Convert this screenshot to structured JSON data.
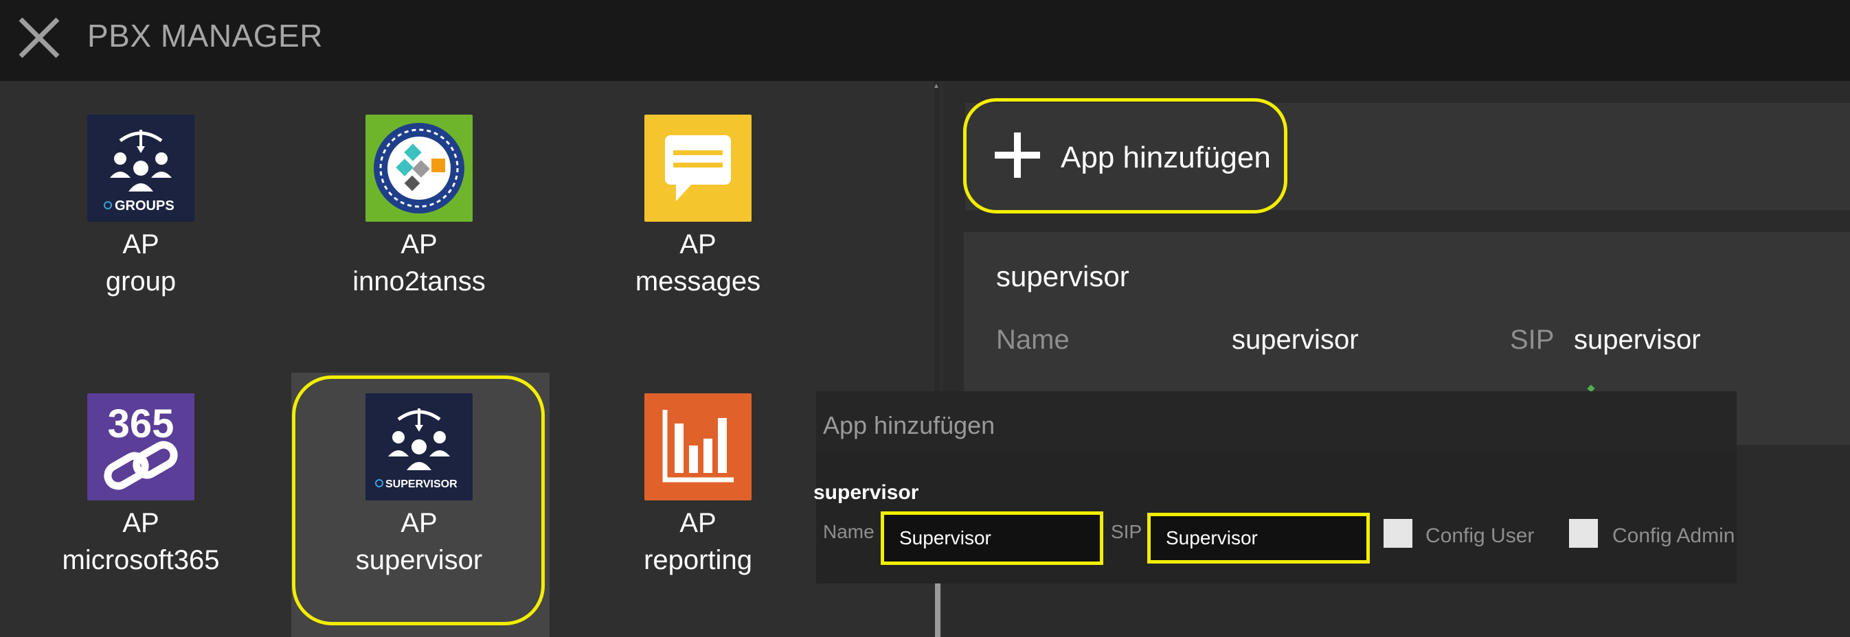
{
  "header": {
    "title": "PBX MANAGER",
    "close_icon": "close-icon"
  },
  "apps": [
    {
      "line1": "AP",
      "line2": "group",
      "icon": "groups-logo-icon",
      "color": "#1b2340",
      "logo_text": "GROUPS"
    },
    {
      "line1": "AP",
      "line2": "inno2tanss",
      "icon": "inno2tanss-logo-icon",
      "color": "#6fb52c"
    },
    {
      "line1": "AP",
      "line2": "messages",
      "icon": "message-bubble-icon",
      "color": "#f4c52c"
    },
    {
      "line1": "AP",
      "line2": "microsoft365",
      "icon": "microsoft365-link-icon",
      "color": "#5b3e97",
      "logo_text": "365"
    },
    {
      "line1": "AP",
      "line2": "supervisor",
      "icon": "supervisor-logo-icon",
      "color": "#1b2340",
      "logo_text": "SUPERVISOR",
      "selected": true
    },
    {
      "line1": "AP",
      "line2": "reporting",
      "icon": "bar-chart-icon",
      "color": "#e0622a"
    }
  ],
  "add_app": {
    "label": "App hinzufügen"
  },
  "card": {
    "title": "supervisor",
    "name_label": "Name",
    "name_value": "supervisor",
    "sip_label": "SIP",
    "sip_value": "supervisor"
  },
  "dialog": {
    "title": "App hinzufügen",
    "subtitle": "supervisor",
    "name_label": "Name",
    "name_value": "Supervisor",
    "sip_label": "SIP",
    "sip_value": "Supervisor",
    "config_user_label": "Config User",
    "config_admin_label": "Config Admin",
    "config_user_checked": false,
    "config_admin_checked": false
  },
  "colors": {
    "highlight": "#f3ee00",
    "header_bg": "#181818",
    "panel_bg": "#2f2f2f"
  }
}
